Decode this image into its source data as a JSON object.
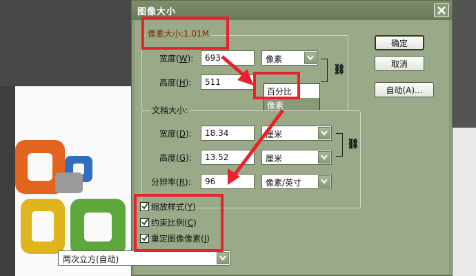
{
  "dialog": {
    "title": "图像大小",
    "pixel_dimensions_title": "像素大小:1.01M",
    "width_label": "宽度",
    "width_key": "W",
    "width_value": "693",
    "width_unit": "像素",
    "height_label": "高度",
    "height_key": "H",
    "height_value": "511",
    "dropdown": {
      "items": [
        "百分比",
        "像素"
      ],
      "selected": "像素"
    },
    "document_size_title": "文档大小:",
    "doc_width_label": "宽度",
    "doc_width_key": "D",
    "doc_width_value": "18.34",
    "doc_width_unit": "厘米",
    "doc_height_label": "高度",
    "doc_height_key": "G",
    "doc_height_value": "13.52",
    "doc_height_unit": "厘米",
    "resolution_label": "分辨率",
    "resolution_key": "R",
    "resolution_value": "96",
    "resolution_unit": "像素/英寸",
    "buttons": {
      "ok": "确定",
      "cancel": "取消",
      "auto": "自动(A)..."
    },
    "checkboxes": [
      {
        "label": "缩放样式",
        "key": "Y",
        "checked": true
      },
      {
        "label": "约束比例",
        "key": "C",
        "checked": true
      },
      {
        "label": "重定图像像素",
        "key": "I",
        "checked": true
      }
    ],
    "resample_method": "两次立方(自动)"
  },
  "colors": {
    "dialog_bg": "#9aa988",
    "annotation_red": "#e8212b"
  }
}
